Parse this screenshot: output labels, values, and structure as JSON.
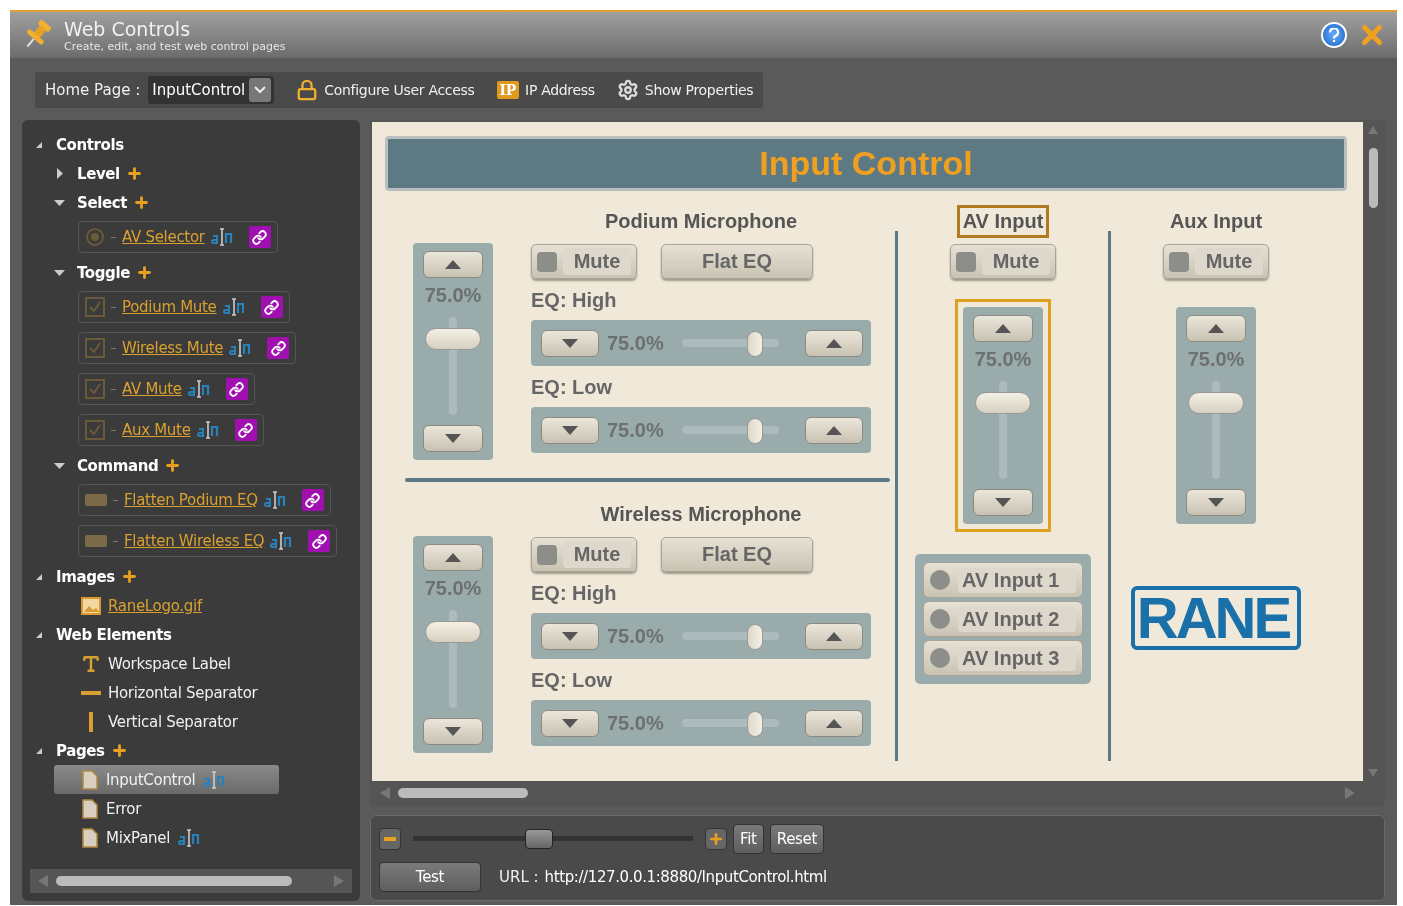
{
  "window": {
    "title": "Web Controls",
    "subtitle": "Create, edit, and test web control pages"
  },
  "toolbar": {
    "home_label": "Home Page :",
    "home_value": "InputControl",
    "actions": [
      {
        "kind": "lock",
        "label": "Configure User Access"
      },
      {
        "kind": "ip",
        "badge": "IP",
        "label": "IP Address"
      },
      {
        "kind": "gear",
        "label": "Show Properties"
      }
    ]
  },
  "tree": [
    {
      "label": "Controls",
      "expanded": true,
      "addable": false,
      "children": [
        {
          "label": "Level",
          "expanded": false,
          "addable": true
        },
        {
          "label": "Select",
          "expanded": true,
          "addable": true,
          "children": [
            {
              "kind": "radio",
              "label": "AV Selector"
            }
          ]
        },
        {
          "label": "Toggle",
          "expanded": true,
          "addable": true,
          "children": [
            {
              "kind": "checkbox",
              "label": "Podium Mute"
            },
            {
              "kind": "checkbox",
              "label": "Wireless Mute"
            },
            {
              "kind": "checkbox",
              "label": "AV Mute"
            },
            {
              "kind": "checkbox",
              "label": "Aux Mute"
            }
          ]
        },
        {
          "label": "Command",
          "expanded": true,
          "addable": true,
          "children": [
            {
              "kind": "command",
              "label": "Flatten Podium EQ"
            },
            {
              "kind": "command",
              "label": "Flatten Wireless EQ"
            }
          ]
        }
      ]
    },
    {
      "label": "Images",
      "expanded": true,
      "addable": true,
      "children": [
        {
          "kind": "image",
          "label": "RaneLogo.gif"
        }
      ]
    },
    {
      "label": "Web Elements",
      "expanded": true,
      "addable": false,
      "children": [
        {
          "kind": "text",
          "label": "Workspace Label"
        },
        {
          "kind": "hsep",
          "label": "Horizontal Separator"
        },
        {
          "kind": "vsep",
          "label": "Vertical Separator"
        }
      ]
    },
    {
      "label": "Pages",
      "expanded": true,
      "addable": true,
      "children": [
        {
          "kind": "page",
          "label": "InputControl",
          "selected": true,
          "renamable": true
        },
        {
          "kind": "page",
          "label": "Error",
          "selected": false,
          "renamable": false
        },
        {
          "kind": "page",
          "label": "MixPanel",
          "selected": false,
          "renamable": true
        }
      ]
    }
  ],
  "canvas": {
    "title": "Input Control",
    "channels": [
      {
        "title": "Podium Microphone",
        "fader": {
          "value": "75.0%",
          "level": 0.75
        },
        "mute": {
          "label": "Mute",
          "on": false
        },
        "flat_eq": "Flat EQ",
        "eq": [
          {
            "label": "EQ: High",
            "value": "75.0%",
            "level": 0.75
          },
          {
            "label": "EQ: Low",
            "value": "75.0%",
            "level": 0.75
          }
        ]
      },
      {
        "title": "Wireless Microphone",
        "fader": {
          "value": "75.0%",
          "level": 0.75
        },
        "mute": {
          "label": "Mute",
          "on": false
        },
        "flat_eq": "Flat EQ",
        "eq": [
          {
            "label": "EQ: High",
            "value": "75.0%",
            "level": 0.75
          },
          {
            "label": "EQ: Low",
            "value": "75.0%",
            "level": 0.75
          }
        ]
      }
    ],
    "av": {
      "title": "AV Input",
      "selected": true,
      "mute": {
        "label": "Mute",
        "on": false
      },
      "fader": {
        "value": "75.0%",
        "level": 0.75,
        "selected": true
      },
      "inputs": [
        {
          "label": "AV Input 1",
          "selected": false
        },
        {
          "label": "AV Input 2",
          "selected": false
        },
        {
          "label": "AV Input 3",
          "selected": false
        }
      ]
    },
    "aux": {
      "title": "Aux Input",
      "selected": false,
      "mute": {
        "label": "Mute",
        "on": false
      },
      "fader": {
        "value": "75.0%",
        "level": 0.75,
        "selected": false
      }
    },
    "logo": "RANE"
  },
  "zoom": {
    "level": 0.45,
    "fit": "Fit",
    "reset": "Reset"
  },
  "test": "Test",
  "url_label": "URL :",
  "url": "http://127.0.0.1:8880/InputControl.html"
}
